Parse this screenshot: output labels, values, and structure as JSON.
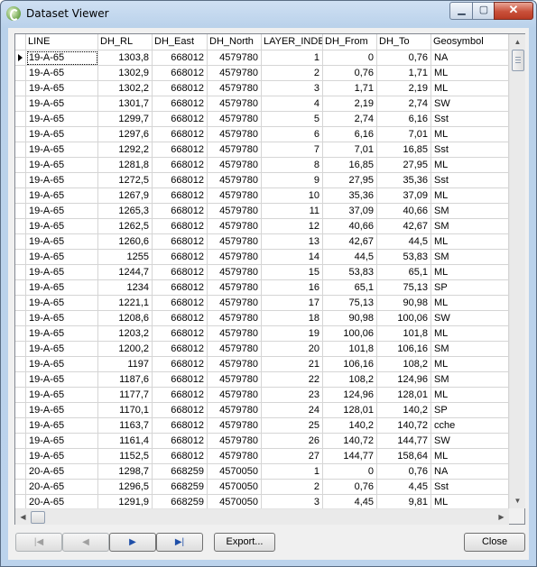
{
  "window": {
    "title": "Dataset Viewer",
    "min_label": "▁",
    "max_label": "▢",
    "close_label": "✕"
  },
  "columns": [
    "LINE",
    "DH_RL",
    "DH_East",
    "DH_North",
    "LAYER_INDEX",
    "DH_From",
    "DH_To",
    "Geosymbol"
  ],
  "rows": [
    [
      "19-A-65",
      "1303,8",
      "668012",
      "4579780",
      "1",
      "0",
      "0,76",
      "NA"
    ],
    [
      "19-A-65",
      "1302,9",
      "668012",
      "4579780",
      "2",
      "0,76",
      "1,71",
      "ML"
    ],
    [
      "19-A-65",
      "1302,2",
      "668012",
      "4579780",
      "3",
      "1,71",
      "2,19",
      "ML"
    ],
    [
      "19-A-65",
      "1301,7",
      "668012",
      "4579780",
      "4",
      "2,19",
      "2,74",
      "SW"
    ],
    [
      "19-A-65",
      "1299,7",
      "668012",
      "4579780",
      "5",
      "2,74",
      "6,16",
      "Sst"
    ],
    [
      "19-A-65",
      "1297,6",
      "668012",
      "4579780",
      "6",
      "6,16",
      "7,01",
      "ML"
    ],
    [
      "19-A-65",
      "1292,2",
      "668012",
      "4579780",
      "7",
      "7,01",
      "16,85",
      "Sst"
    ],
    [
      "19-A-65",
      "1281,8",
      "668012",
      "4579780",
      "8",
      "16,85",
      "27,95",
      "ML"
    ],
    [
      "19-A-65",
      "1272,5",
      "668012",
      "4579780",
      "9",
      "27,95",
      "35,36",
      "Sst"
    ],
    [
      "19-A-65",
      "1267,9",
      "668012",
      "4579780",
      "10",
      "35,36",
      "37,09",
      "ML"
    ],
    [
      "19-A-65",
      "1265,3",
      "668012",
      "4579780",
      "11",
      "37,09",
      "40,66",
      "SM"
    ],
    [
      "19-A-65",
      "1262,5",
      "668012",
      "4579780",
      "12",
      "40,66",
      "42,67",
      "SM"
    ],
    [
      "19-A-65",
      "1260,6",
      "668012",
      "4579780",
      "13",
      "42,67",
      "44,5",
      "ML"
    ],
    [
      "19-A-65",
      "1255",
      "668012",
      "4579780",
      "14",
      "44,5",
      "53,83",
      "SM"
    ],
    [
      "19-A-65",
      "1244,7",
      "668012",
      "4579780",
      "15",
      "53,83",
      "65,1",
      "ML"
    ],
    [
      "19-A-65",
      "1234",
      "668012",
      "4579780",
      "16",
      "65,1",
      "75,13",
      "SP"
    ],
    [
      "19-A-65",
      "1221,1",
      "668012",
      "4579780",
      "17",
      "75,13",
      "90,98",
      "ML"
    ],
    [
      "19-A-65",
      "1208,6",
      "668012",
      "4579780",
      "18",
      "90,98",
      "100,06",
      "SW"
    ],
    [
      "19-A-65",
      "1203,2",
      "668012",
      "4579780",
      "19",
      "100,06",
      "101,8",
      "ML"
    ],
    [
      "19-A-65",
      "1200,2",
      "668012",
      "4579780",
      "20",
      "101,8",
      "106,16",
      "SM"
    ],
    [
      "19-A-65",
      "1197",
      "668012",
      "4579780",
      "21",
      "106,16",
      "108,2",
      "ML"
    ],
    [
      "19-A-65",
      "1187,6",
      "668012",
      "4579780",
      "22",
      "108,2",
      "124,96",
      "SM"
    ],
    [
      "19-A-65",
      "1177,7",
      "668012",
      "4579780",
      "23",
      "124,96",
      "128,01",
      "ML"
    ],
    [
      "19-A-65",
      "1170,1",
      "668012",
      "4579780",
      "24",
      "128,01",
      "140,2",
      "SP"
    ],
    [
      "19-A-65",
      "1163,7",
      "668012",
      "4579780",
      "25",
      "140,2",
      "140,72",
      "cche"
    ],
    [
      "19-A-65",
      "1161,4",
      "668012",
      "4579780",
      "26",
      "140,72",
      "144,77",
      "SW"
    ],
    [
      "19-A-65",
      "1152,5",
      "668012",
      "4579780",
      "27",
      "144,77",
      "158,64",
      "ML"
    ],
    [
      "20-A-65",
      "1298,7",
      "668259",
      "4570050",
      "1",
      "0",
      "0,76",
      "NA"
    ],
    [
      "20-A-65",
      "1296,5",
      "668259",
      "4570050",
      "2",
      "0,76",
      "4,45",
      "Sst"
    ],
    [
      "20-A-65",
      "1291,9",
      "668259",
      "4570050",
      "3",
      "4,45",
      "9,81",
      "ML"
    ]
  ],
  "footer": {
    "first_label": "|◀",
    "prev_label": "◀",
    "next_label": "▶",
    "last_label": "▶|",
    "export_label": "Export...",
    "close_label": "Close"
  },
  "scroll": {
    "up": "▲",
    "down": "▼",
    "left": "◀",
    "right": "▶"
  }
}
